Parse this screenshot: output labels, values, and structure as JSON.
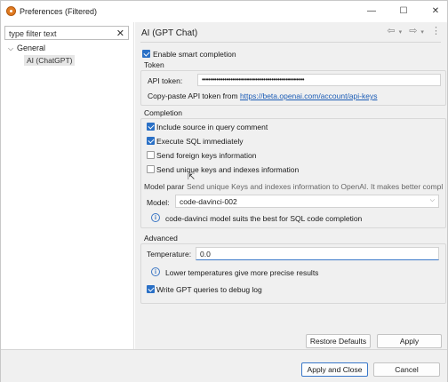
{
  "window": {
    "title": "Preferences (Filtered)",
    "controls": {
      "minimize": "—",
      "maximize": "☐",
      "close": "✕"
    }
  },
  "filter": {
    "value": "type filter text",
    "clear": "✕"
  },
  "tree": {
    "general": "General",
    "child": "AI (ChatGPT)"
  },
  "page": {
    "title": "AI (GPT Chat)",
    "nav": {
      "back": "⇦",
      "back_menu": "▾",
      "forward": "⇨",
      "forward_menu": "▾",
      "menu": "⋮"
    }
  },
  "settings": {
    "enable_smart_completion": {
      "label": "Enable smart completion",
      "checked": true
    },
    "token": {
      "group_label": "Token",
      "api_token_label": "API token:",
      "api_token_value": "••••••••••••••••••••••••••••••••••••••••••••••••••",
      "hint_prefix": "Copy-paste API token from ",
      "hint_link": "https://beta.openai.com/account/api-keys"
    },
    "completion": {
      "group_label": "Completion",
      "include_source": {
        "label": "Include source in query comment",
        "checked": true
      },
      "execute_sql": {
        "label": "Execute SQL immediately",
        "checked": true
      },
      "send_foreign_keys": {
        "label": "Send foreign keys information",
        "checked": false
      },
      "send_unique_keys": {
        "label": "Send unique keys and indexes information",
        "checked": false
      },
      "tooltip_prefix": "Model parar",
      "tooltip_text": "Send unique Keys and indexes information to OpenAI. It makes better compl",
      "model_label": "Model:",
      "model_value": "code-davinci-002",
      "model_info": "code-davinci model suits the best for SQL code completion"
    },
    "advanced": {
      "group_label": "Advanced",
      "temperature_label": "Temperature:",
      "temperature_value": "0.0",
      "temperature_info": "Lower temperatures give more precise results",
      "write_log": {
        "label": "Write GPT queries to debug log",
        "checked": true
      }
    }
  },
  "buttons": {
    "restore_defaults": "Restore Defaults",
    "apply": "Apply",
    "apply_and_close": "Apply and Close",
    "cancel": "Cancel"
  },
  "colors": {
    "accent": "#2a70c6",
    "link": "#1a5bb5",
    "pane_bg": "#f0f0f0"
  }
}
